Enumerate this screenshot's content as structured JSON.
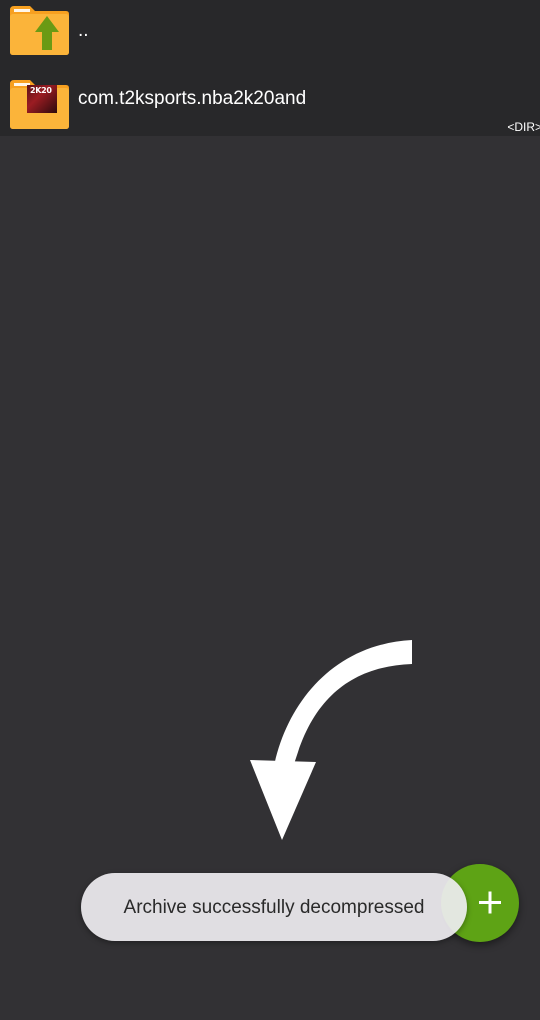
{
  "file_list": {
    "items": [
      {
        "name": "..",
        "icon": "folder-up-icon"
      },
      {
        "name": "com.t2ksports.nba2k20and",
        "type_label": "<DIR>",
        "icon": "folder-icon",
        "thumbnail_label": "2K20"
      }
    ]
  },
  "toast": {
    "message": "Archive successfully decompressed"
  },
  "fab": {
    "icon": "plus-icon",
    "color": "#5ea315"
  },
  "colors": {
    "background": "#323134",
    "list_background": "#28282a",
    "folder": "#f7a020",
    "up_arrow": "#6a9a14"
  }
}
